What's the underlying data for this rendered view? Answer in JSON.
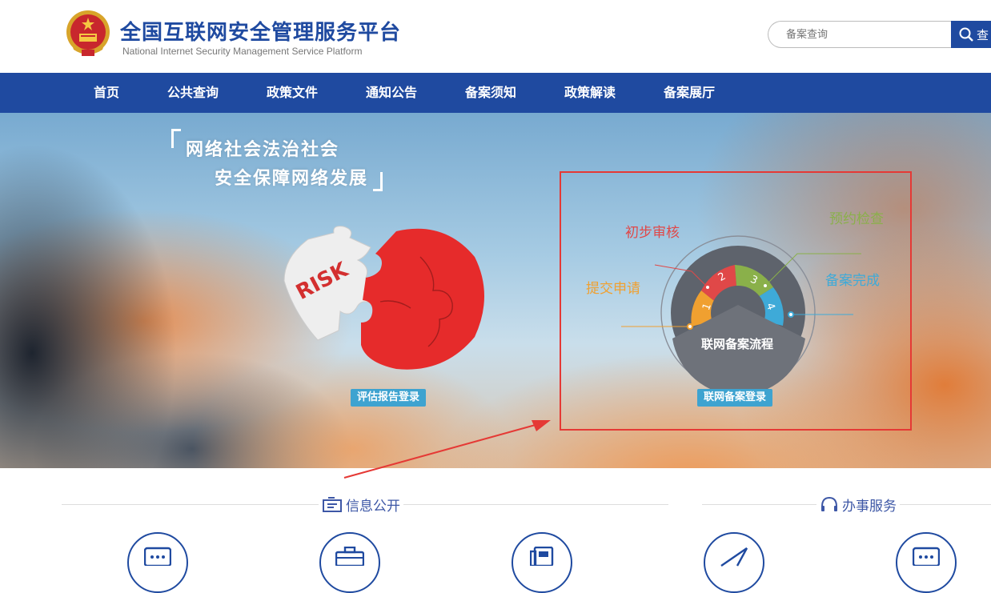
{
  "header": {
    "title": "全国互联网安全管理服务平台",
    "subtitle": "National Internet Security Management Service Platform",
    "search_placeholder": "备案查询",
    "search_button": "查"
  },
  "nav": {
    "items": [
      "首页",
      "公共查询",
      "政策文件",
      "通知公告",
      "备案须知",
      "政策解读",
      "备案展厅"
    ]
  },
  "banner": {
    "slogan_line1": "网络社会法治社会",
    "slogan_line2": "安全保障网络发展",
    "risk_text": "RISK",
    "eval_login": "评估报告登录",
    "filing_login": "联网备案登录",
    "process_center": "联网备案流程",
    "steps": [
      {
        "num": "1",
        "label": "提交申请",
        "color": "#f0a030"
      },
      {
        "num": "2",
        "label": "初步审核",
        "color": "#e04848"
      },
      {
        "num": "3",
        "label": "预约检查",
        "color": "#8ab04a"
      },
      {
        "num": "4",
        "label": "备案完成",
        "color": "#3eaad8"
      }
    ]
  },
  "sections": {
    "info_public": "信息公开",
    "services": "办事服务"
  },
  "colors": {
    "brand": "#1f4aa0",
    "highlight": "#e53935",
    "tag": "#3ea3d0"
  }
}
